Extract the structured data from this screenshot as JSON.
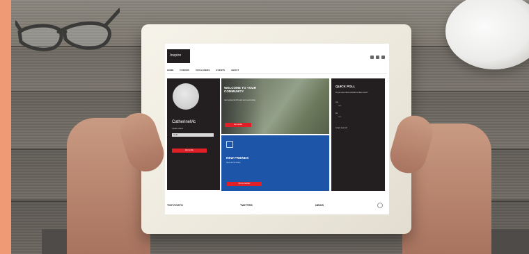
{
  "site": {
    "logo": "Inspire",
    "nav": [
      "HOME",
      "FORUMS",
      "VOCALISERS",
      "EVENTS",
      "ABOUT"
    ]
  },
  "profile": {
    "username": "CatherineMc",
    "label": "Update status",
    "field_value": "Hello",
    "button_label": "Edit profile"
  },
  "welcome": {
    "title": "WELCOME TO YOUR COMMUNITY",
    "subtitle": "Get involved with friends and events today",
    "button_label": "Get started"
  },
  "new_friends": {
    "title": "NEW FRIENDS",
    "subtitle": "View all members",
    "button_label": "Find a member"
  },
  "poll": {
    "title": "QUICK POLL",
    "question": "Do you use online networks to share news?",
    "options": [
      "Yes",
      "No"
    ],
    "percents": [
      "68%",
      "32%"
    ],
    "more_label": "Create new poll"
  },
  "footer": {
    "top_posts": "TOP POSTS",
    "twitter": "TWITTER",
    "news": "NEWS"
  },
  "colors": {
    "accent_red": "#e01f26",
    "panel_dark": "#231f20",
    "panel_blue": "#1d56a8",
    "side_strip": "#ef9a74"
  }
}
